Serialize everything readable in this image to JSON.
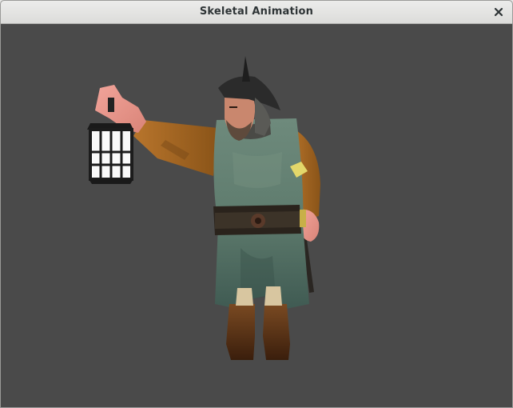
{
  "window": {
    "title": "Skeletal Animation",
    "close_icon": "close-icon"
  },
  "viewport": {
    "background": "#4a4a4a",
    "model": "lantern-guard-character"
  }
}
